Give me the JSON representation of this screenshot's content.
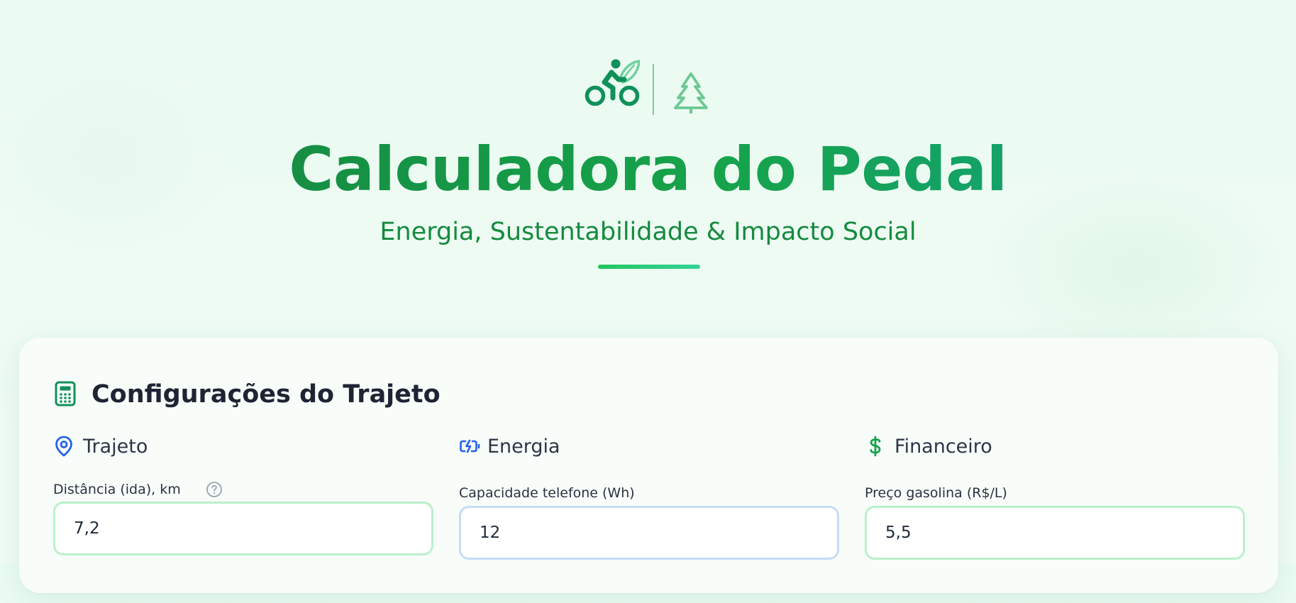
{
  "header": {
    "icons": [
      "bike-leaf-icon",
      "tree-icon"
    ],
    "title": "Calculadora do Pedal",
    "subtitle": "Energia, Sustentabilidade & Impacto Social"
  },
  "config_card": {
    "icon": "calculator-icon",
    "title": "Configurações do Trajeto",
    "sections": [
      {
        "icon": "map-pin-icon",
        "label": "Trajeto",
        "field_label": "Distância (ida), km",
        "help_icon": "help-circle-icon",
        "value": "7,2"
      },
      {
        "icon": "battery-charging-icon",
        "label": "Energia",
        "field_label": "Capacidade telefone (Wh)",
        "value": "12"
      },
      {
        "icon": "dollar-sign-icon",
        "label": "Financeiro",
        "field_label": "Preço gasolina (R$/L)",
        "value": "5,5"
      }
    ]
  },
  "colors": {
    "brand_green": "#16a34a",
    "brand_teal": "#12a18a",
    "pin_blue": "#2563eb",
    "input_border_green": "#bbf0cc",
    "input_border_blue": "#c4dcf8",
    "text_dark": "#1e2433"
  }
}
